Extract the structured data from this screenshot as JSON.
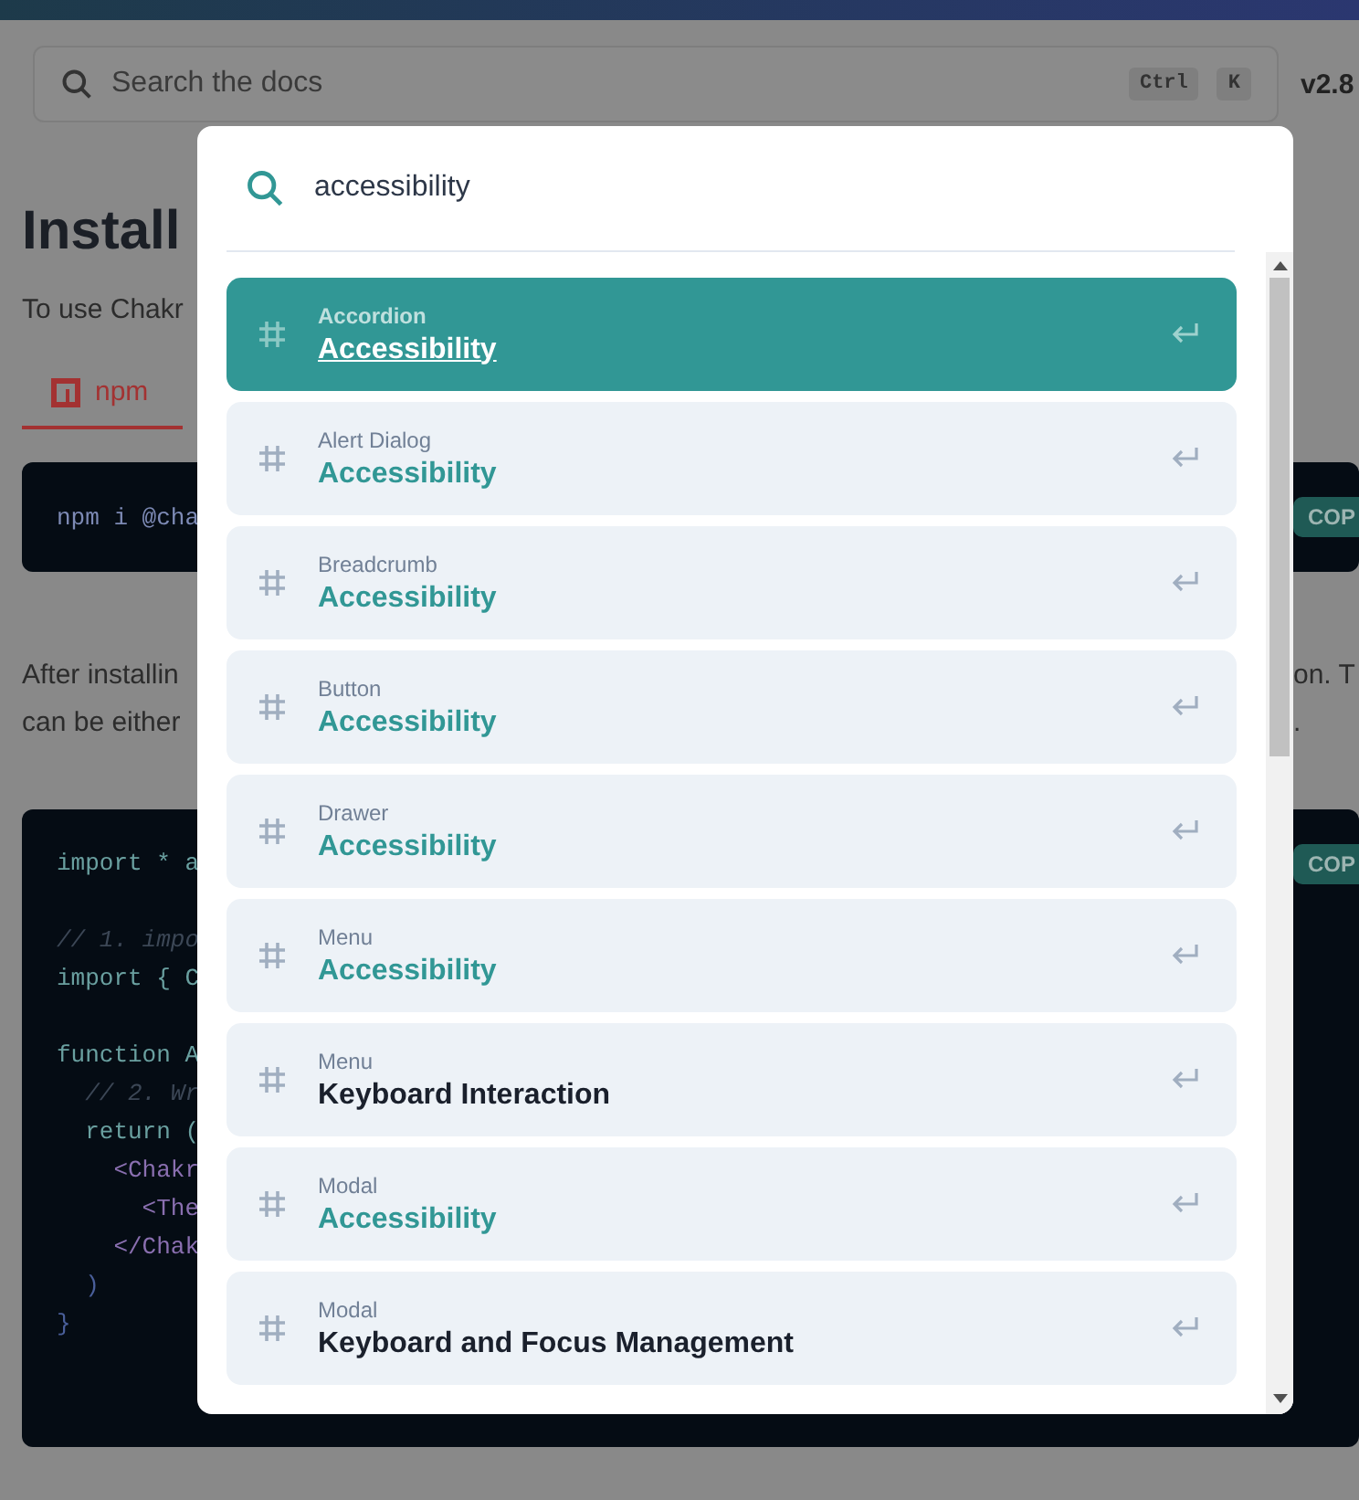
{
  "header": {
    "search": {
      "placeholder": "Search the docs",
      "keys": [
        "Ctrl",
        "K"
      ]
    },
    "version": "v2.8"
  },
  "page": {
    "heading": "Install",
    "intro": "To use Chakr",
    "tabs": [
      {
        "label": "npm",
        "selected": true
      }
    ],
    "install_code": {
      "line": "npm i @cha",
      "copy": "COP"
    },
    "paragraph": {
      "left": [
        "After installin",
        "can be either"
      ],
      "right": [
        "on. T",
        "."
      ]
    },
    "setup_code": {
      "copy": "COP",
      "lines": [
        {
          "text": "import * a",
          "kind": "code"
        },
        {
          "kind": "blank"
        },
        {
          "text": "// 1. impo",
          "kind": "comment"
        },
        {
          "text": "import { C",
          "kind": "code"
        },
        {
          "kind": "blank"
        },
        {
          "text": "function A",
          "kind": "code"
        },
        {
          "text": "  // 2. Wr",
          "kind": "comment"
        },
        {
          "text": "  return (",
          "kind": "code"
        },
        {
          "text": "    <Chakr",
          "kind": "tag"
        },
        {
          "text": "      <The",
          "kind": "tag"
        },
        {
          "text": "    </Chak",
          "kind": "tag"
        },
        {
          "text": "  )",
          "kind": "punct"
        },
        {
          "text": "}",
          "kind": "punct"
        }
      ]
    }
  },
  "search_modal": {
    "query": "accessibility",
    "results": [
      {
        "parent": "Accordion",
        "title": "Accessibility",
        "selected": true,
        "matched": true
      },
      {
        "parent": "Alert Dialog",
        "title": "Accessibility",
        "selected": false,
        "matched": true
      },
      {
        "parent": "Breadcrumb",
        "title": "Accessibility",
        "selected": false,
        "matched": true
      },
      {
        "parent": "Button",
        "title": "Accessibility",
        "selected": false,
        "matched": true
      },
      {
        "parent": "Drawer",
        "title": "Accessibility",
        "selected": false,
        "matched": true
      },
      {
        "parent": "Menu",
        "title": "Accessibility",
        "selected": false,
        "matched": true
      },
      {
        "parent": "Menu",
        "title": "Keyboard Interaction",
        "selected": false,
        "matched": false
      },
      {
        "parent": "Modal",
        "title": "Accessibility",
        "selected": false,
        "matched": true
      },
      {
        "parent": "Modal",
        "title": "Keyboard and Focus Management",
        "selected": false,
        "matched": false
      }
    ]
  }
}
